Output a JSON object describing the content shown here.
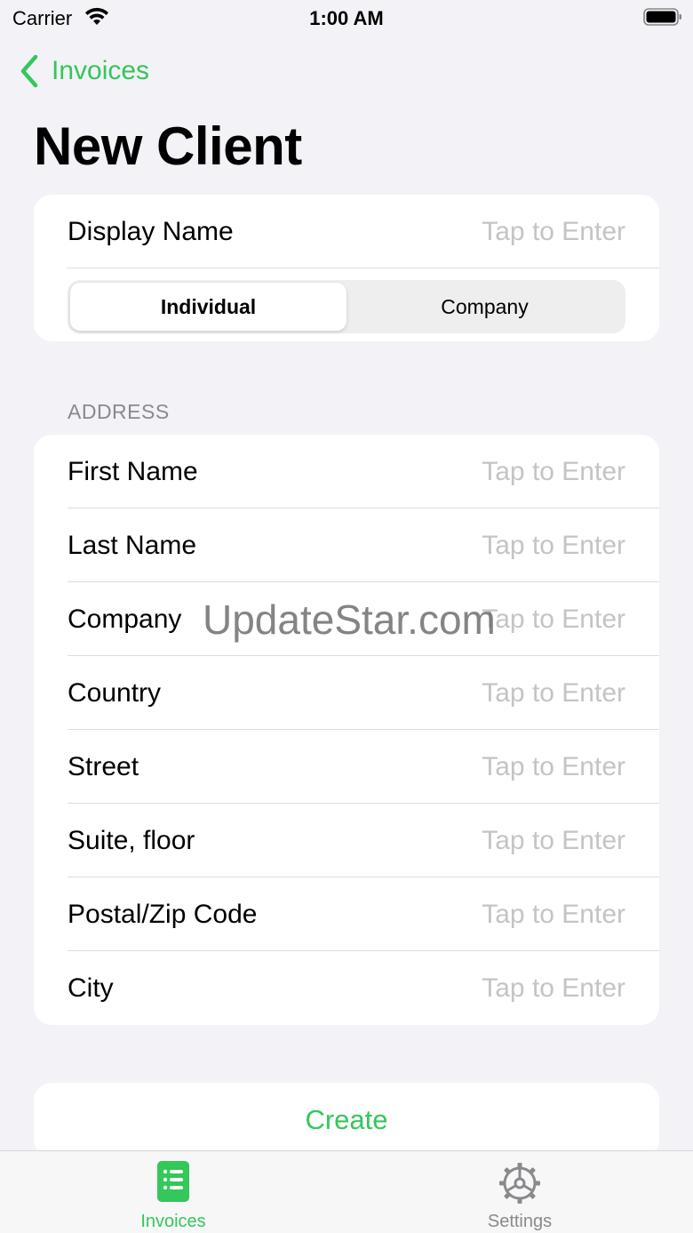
{
  "status_bar": {
    "carrier": "Carrier",
    "time": "1:00 AM"
  },
  "nav": {
    "back_label": "Invoices",
    "accent_color": "#34c759"
  },
  "page": {
    "title": "New Client"
  },
  "name_section": {
    "display_name_label": "Display Name",
    "display_name_placeholder": "Tap to Enter",
    "segments": [
      "Individual",
      "Company"
    ],
    "selected_segment": "Individual"
  },
  "address_section": {
    "header": "ADDRESS",
    "fields": [
      {
        "label": "First Name",
        "placeholder": "Tap to Enter"
      },
      {
        "label": "Last Name",
        "placeholder": "Tap to Enter"
      },
      {
        "label": "Company",
        "placeholder": "Tap to Enter"
      },
      {
        "label": "Country",
        "placeholder": "Tap to Enter"
      },
      {
        "label": "Street",
        "placeholder": "Tap to Enter"
      },
      {
        "label": "Suite, floor",
        "placeholder": "Tap to Enter"
      },
      {
        "label": "Postal/Zip Code",
        "placeholder": "Tap to Enter"
      },
      {
        "label": "City",
        "placeholder": "Tap to Enter"
      }
    ]
  },
  "actions": {
    "create_label": "Create"
  },
  "watermark": "UpdateStar.com",
  "tab_bar": {
    "tabs": [
      {
        "label": "Invoices",
        "icon": "invoice-list-icon",
        "active": true
      },
      {
        "label": "Settings",
        "icon": "gear-icon",
        "active": false
      }
    ]
  }
}
